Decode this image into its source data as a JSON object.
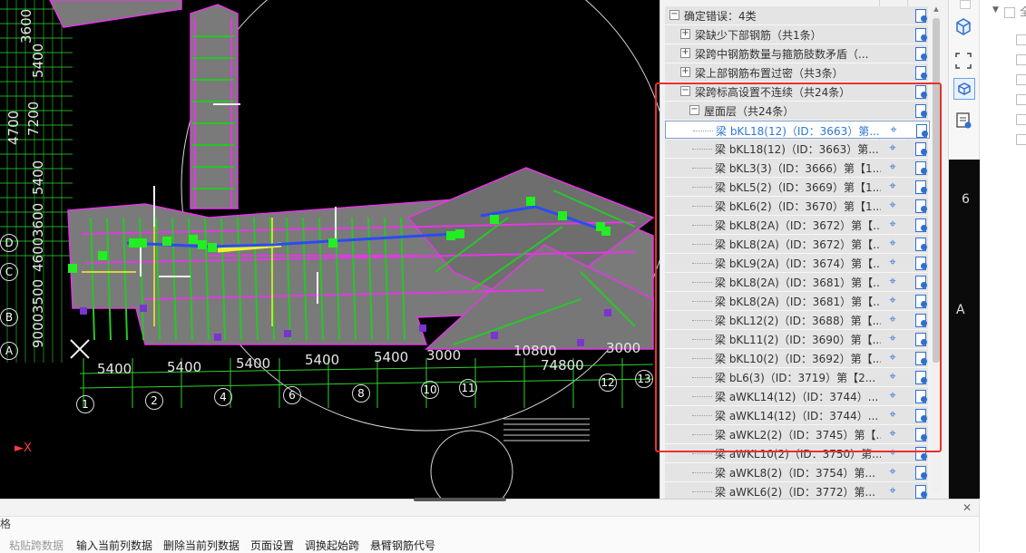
{
  "cad": {
    "dim_top": [
      "5400",
      "5400",
      "5400",
      "5400",
      "5400",
      "3000",
      "3000"
    ],
    "dim_total": "74800",
    "dim_mid": "10800",
    "left_dims": [
      "3600",
      "5400",
      "7200",
      "4700",
      "5400",
      "3600",
      "4600",
      "3500",
      "9000"
    ],
    "axis_numbers": [
      "1",
      "2",
      "4",
      "6",
      "8",
      "10",
      "11",
      "12",
      "13"
    ],
    "axis_letters": [
      "D",
      "C",
      "B",
      "A"
    ],
    "right_letters": [
      "A"
    ],
    "right_number": "6",
    "x_axis_label": "X",
    "colors": {
      "background": "#000000",
      "slab": "#7a7a7a",
      "magenta": "#e636e6",
      "green": "#29c629",
      "yellow": "#f1f130",
      "blue": "#2a4bf5",
      "node": "#22ee22",
      "purple": "#7a34d0"
    }
  },
  "tree": {
    "root": "确定错误：4类",
    "groups": [
      {
        "label": "梁缺少下部钢筋（共1条）",
        "expanded": false
      },
      {
        "label": "梁跨中钢筋数量与箍筋肢数矛盾（...",
        "expanded": false
      },
      {
        "label": "梁上部钢筋布置过密（共3条）",
        "expanded": false
      },
      {
        "label": "梁跨标高设置不连续（共24条）",
        "expanded": true
      }
    ],
    "subgroup": "屋面层（共24条）",
    "items": [
      "梁 bKL18(12)（ID：3663）第...",
      "梁 bKL18(12)（ID：3663）第...",
      "梁 bKL3(3)（ID：3666）第【1...",
      "梁 bKL5(2)（ID：3669）第【1...",
      "梁 bKL6(2)（ID：3670）第【1...",
      "梁 bKL8(2A)（ID：3672）第【...",
      "梁 bKL8(2A)（ID：3672）第【...",
      "梁 bKL9(2A)（ID：3674）第【...",
      "梁 bKL8(2A)（ID：3681）第【...",
      "梁 bKL8(2A)（ID：3681）第【...",
      "梁 bKL12(2)（ID：3688）第【...",
      "梁 bKL11(2)（ID：3690）第【...",
      "梁 bKL10(2)（ID：3692）第【...",
      "梁 bL6(3)（ID：3719）第【2...",
      "梁 aWKL14(12)（ID：3744）...",
      "梁 aWKL14(12)（ID：3744）...",
      "梁 aWKL2(2)（ID：3745）第【...",
      "梁 aWKL10(2)（ID：3750）第...",
      "梁 aWKL8(2)（ID：3754）第...",
      "梁 aWKL6(2)（ID：3772）第..."
    ],
    "selected_index": 0,
    "locate_icon": "crosshair-icon",
    "detail_icon": "document-icon"
  },
  "toolbar_right": {
    "icons": [
      "cube-icon",
      "select-frame-icon",
      "3d-view-icon",
      "report-view-icon"
    ]
  },
  "bottom": {
    "left_char": "格",
    "buttons": [
      {
        "label": "粘贴跨数据",
        "enabled": false
      },
      {
        "label": "输入当前列数据",
        "enabled": true
      },
      {
        "label": "删除当前列数据",
        "enabled": true
      },
      {
        "label": "页面设置",
        "enabled": true
      },
      {
        "label": "调换起始跨",
        "enabled": true
      },
      {
        "label": "悬臂钢筋代号",
        "enabled": true
      }
    ]
  },
  "far_right": {
    "text": "全"
  }
}
